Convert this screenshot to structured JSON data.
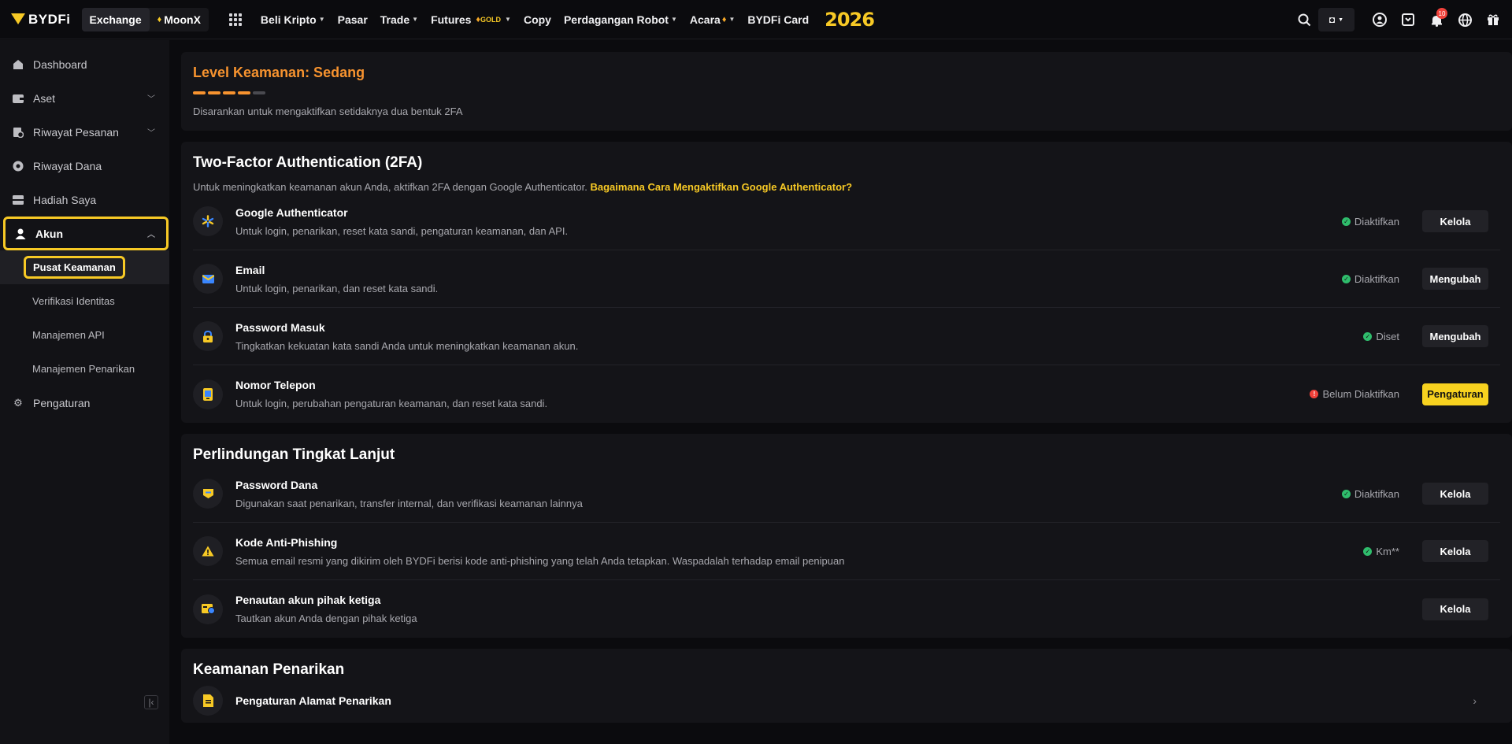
{
  "topbar": {
    "logo": "BYDFi",
    "modes": [
      "Exchange",
      "MoonX"
    ],
    "nav": [
      {
        "label": "Beli Kripto",
        "caret": true
      },
      {
        "label": "Pasar",
        "caret": false
      },
      {
        "label": "Trade",
        "caret": true
      },
      {
        "label": "Futures",
        "caret": true,
        "badge": "GOLD"
      },
      {
        "label": "Copy",
        "caret": false
      },
      {
        "label": "Perdagangan Robot",
        "caret": true
      },
      {
        "label": "Acara",
        "caret": true
      },
      {
        "label": "BYDFi Card",
        "caret": false
      }
    ],
    "year": "2026",
    "notif_count": "10"
  },
  "sidebar": {
    "items": [
      {
        "label": "Dashboard",
        "icon": "home-icon"
      },
      {
        "label": "Aset",
        "icon": "wallet-icon"
      },
      {
        "label": "Riwayat Pesanan",
        "icon": "order-history-icon"
      },
      {
        "label": "Riwayat Dana",
        "icon": "fund-history-icon"
      },
      {
        "label": "Hadiah Saya",
        "icon": "gift-icon"
      },
      {
        "label": "Akun",
        "icon": "user-icon"
      }
    ],
    "sub": [
      "Pusat Keamanan",
      "Verifikasi Identitas",
      "Manajemen API",
      "Manajemen Penarikan"
    ],
    "settings": "Pengaturan"
  },
  "level": {
    "title": "Level Keamanan: Sedang",
    "note": "Disarankan untuk mengaktifkan setidaknya dua bentuk 2FA",
    "filled": 4,
    "total": 5
  },
  "twofa": {
    "title": "Two-Factor Authentication (2FA)",
    "desc": "Untuk meningkatkan keamanan akun Anda, aktifkan 2FA dengan Google Authenticator.",
    "link": "Bagaimana Cara Mengaktifkan Google Authenticator?",
    "rows": [
      {
        "title": "Google Authenticator",
        "sub": "Untuk login, penarikan, reset kata sandi, pengaturan keamanan, dan API.",
        "status": "Diaktifkan",
        "button": "Kelola"
      },
      {
        "title": "Email",
        "sub": "Untuk login, penarikan, dan reset kata sandi.",
        "status": "Diaktifkan",
        "button": "Mengubah"
      },
      {
        "title": "Password Masuk",
        "sub": "Tingkatkan kekuatan kata sandi Anda untuk meningkatkan keamanan akun.",
        "status": "Diset",
        "button": "Mengubah"
      },
      {
        "title": "Nomor Telepon",
        "sub": "Untuk login, perubahan pengaturan keamanan, dan reset kata sandi.",
        "status": "Belum Diaktifkan",
        "button": "Pengaturan"
      }
    ]
  },
  "advanced": {
    "title": "Perlindungan Tingkat Lanjut",
    "rows": [
      {
        "title": "Password Dana",
        "sub": "Digunakan saat penarikan, transfer internal, dan verifikasi keamanan lainnya",
        "status": "Diaktifkan",
        "button": "Kelola"
      },
      {
        "title": "Kode Anti-Phishing",
        "sub": "Semua email resmi yang dikirim oleh BYDFi berisi kode anti-phishing yang telah Anda tetapkan. Waspadalah terhadap email penipuan",
        "status": "Km**",
        "button": "Kelola"
      },
      {
        "title": "Penautan akun pihak ketiga",
        "sub": "Tautkan akun Anda dengan pihak ketiga",
        "button": "Kelola"
      }
    ]
  },
  "withdrawal": {
    "title": "Keamanan Penarikan",
    "rows": [
      {
        "title": "Pengaturan Alamat Penarikan"
      }
    ]
  }
}
